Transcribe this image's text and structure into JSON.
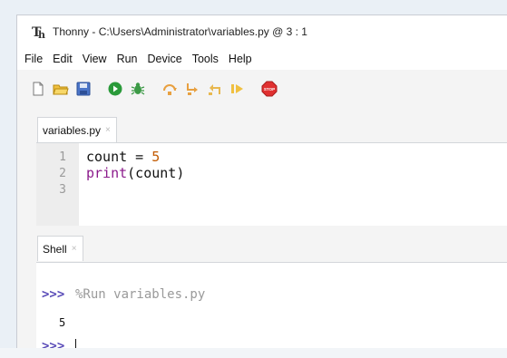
{
  "window": {
    "title": "Thonny  -  C:\\Users\\Administrator\\variables.py  @  3 : 1"
  },
  "menu": [
    "File",
    "Edit",
    "View",
    "Run",
    "Device",
    "Tools",
    "Help"
  ],
  "toolbar": [
    "new-file-icon",
    "open-file-icon",
    "save-icon",
    "run-icon",
    "debug-icon",
    "step-over-icon",
    "step-into-icon",
    "step-out-icon",
    "resume-icon",
    "stop-icon"
  ],
  "editor": {
    "tab_label": "variables.py",
    "tab_close": "×",
    "line_numbers": [
      "1",
      "2",
      "3"
    ],
    "lines": [
      {
        "var": "count",
        "op": " = ",
        "num": "5"
      },
      {
        "fn": "print",
        "args": "(count)"
      }
    ]
  },
  "shell": {
    "tab_label": "Shell",
    "tab_close": "×",
    "prompt": ">>>",
    "command": "%Run variables.py",
    "output": "5"
  },
  "colors": {
    "prompt": "#5a4cb8",
    "number": "#c25a00",
    "builtin": "#8b1a8b",
    "stop": "#e03030",
    "run": "#2a9a3a"
  }
}
